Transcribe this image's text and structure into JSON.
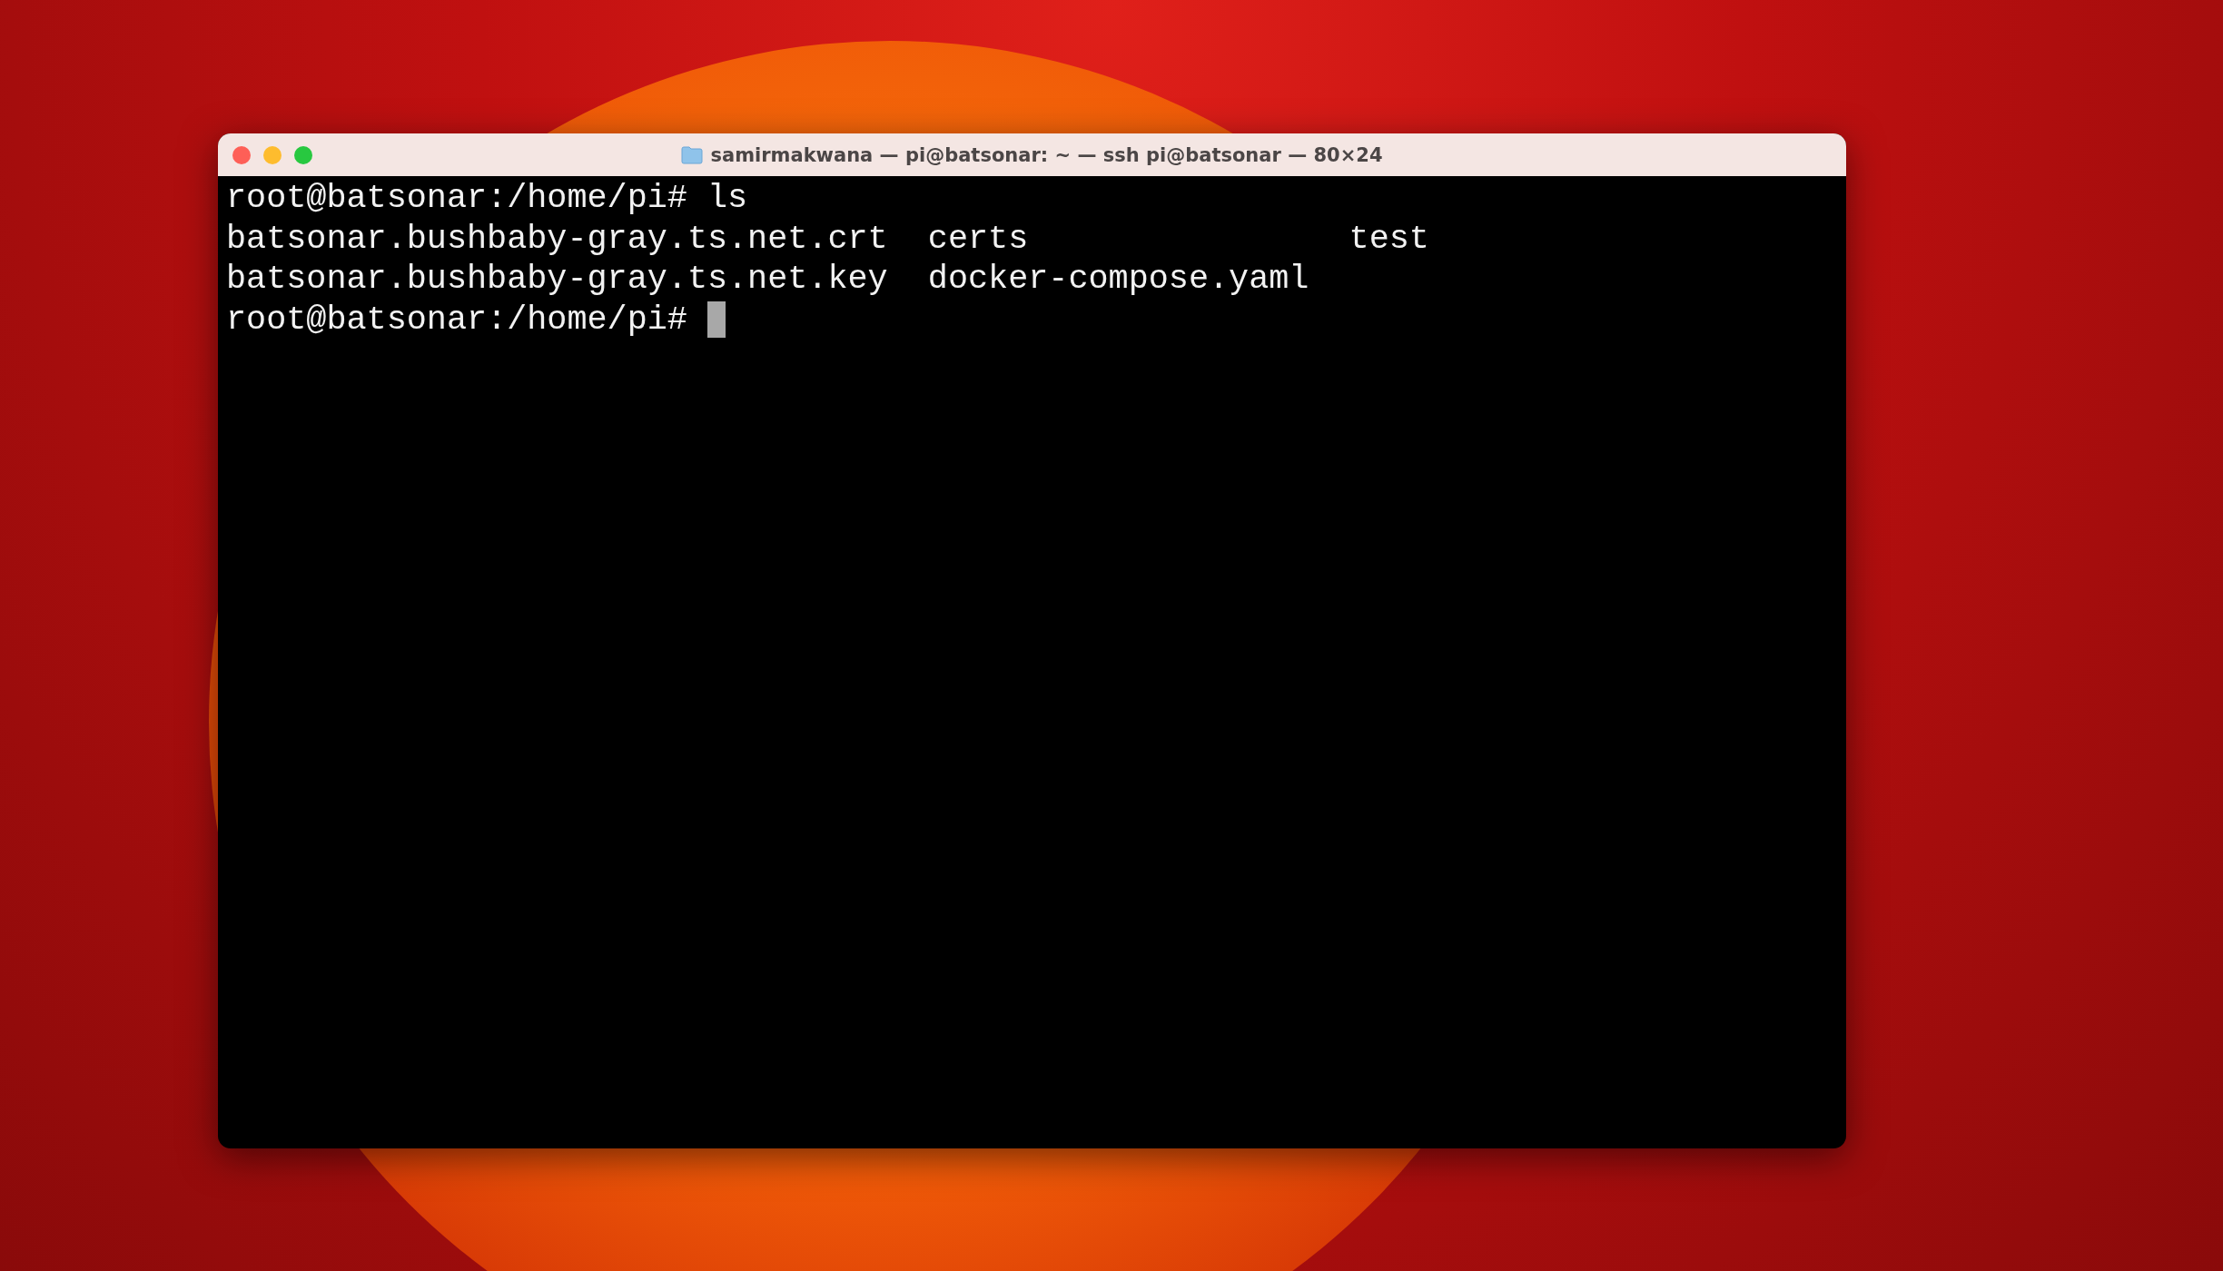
{
  "window": {
    "title": "samirmakwana — pi@batsonar: ~ — ssh pi@batsonar — 80×24"
  },
  "terminal": {
    "lines": [
      {
        "kind": "prompt",
        "prompt": "root@batsonar:/home/pi#",
        "command": "ls",
        "cursor": false
      },
      {
        "kind": "listing",
        "entries": [
          "batsonar.bushbaby-gray.ts.net.crt",
          "certs",
          "test"
        ]
      },
      {
        "kind": "listing",
        "entries": [
          "batsonar.bushbaby-gray.ts.net.key",
          "docker-compose.yaml"
        ]
      },
      {
        "kind": "prompt",
        "prompt": "root@batsonar:/home/pi#",
        "cursor": true
      }
    ]
  }
}
